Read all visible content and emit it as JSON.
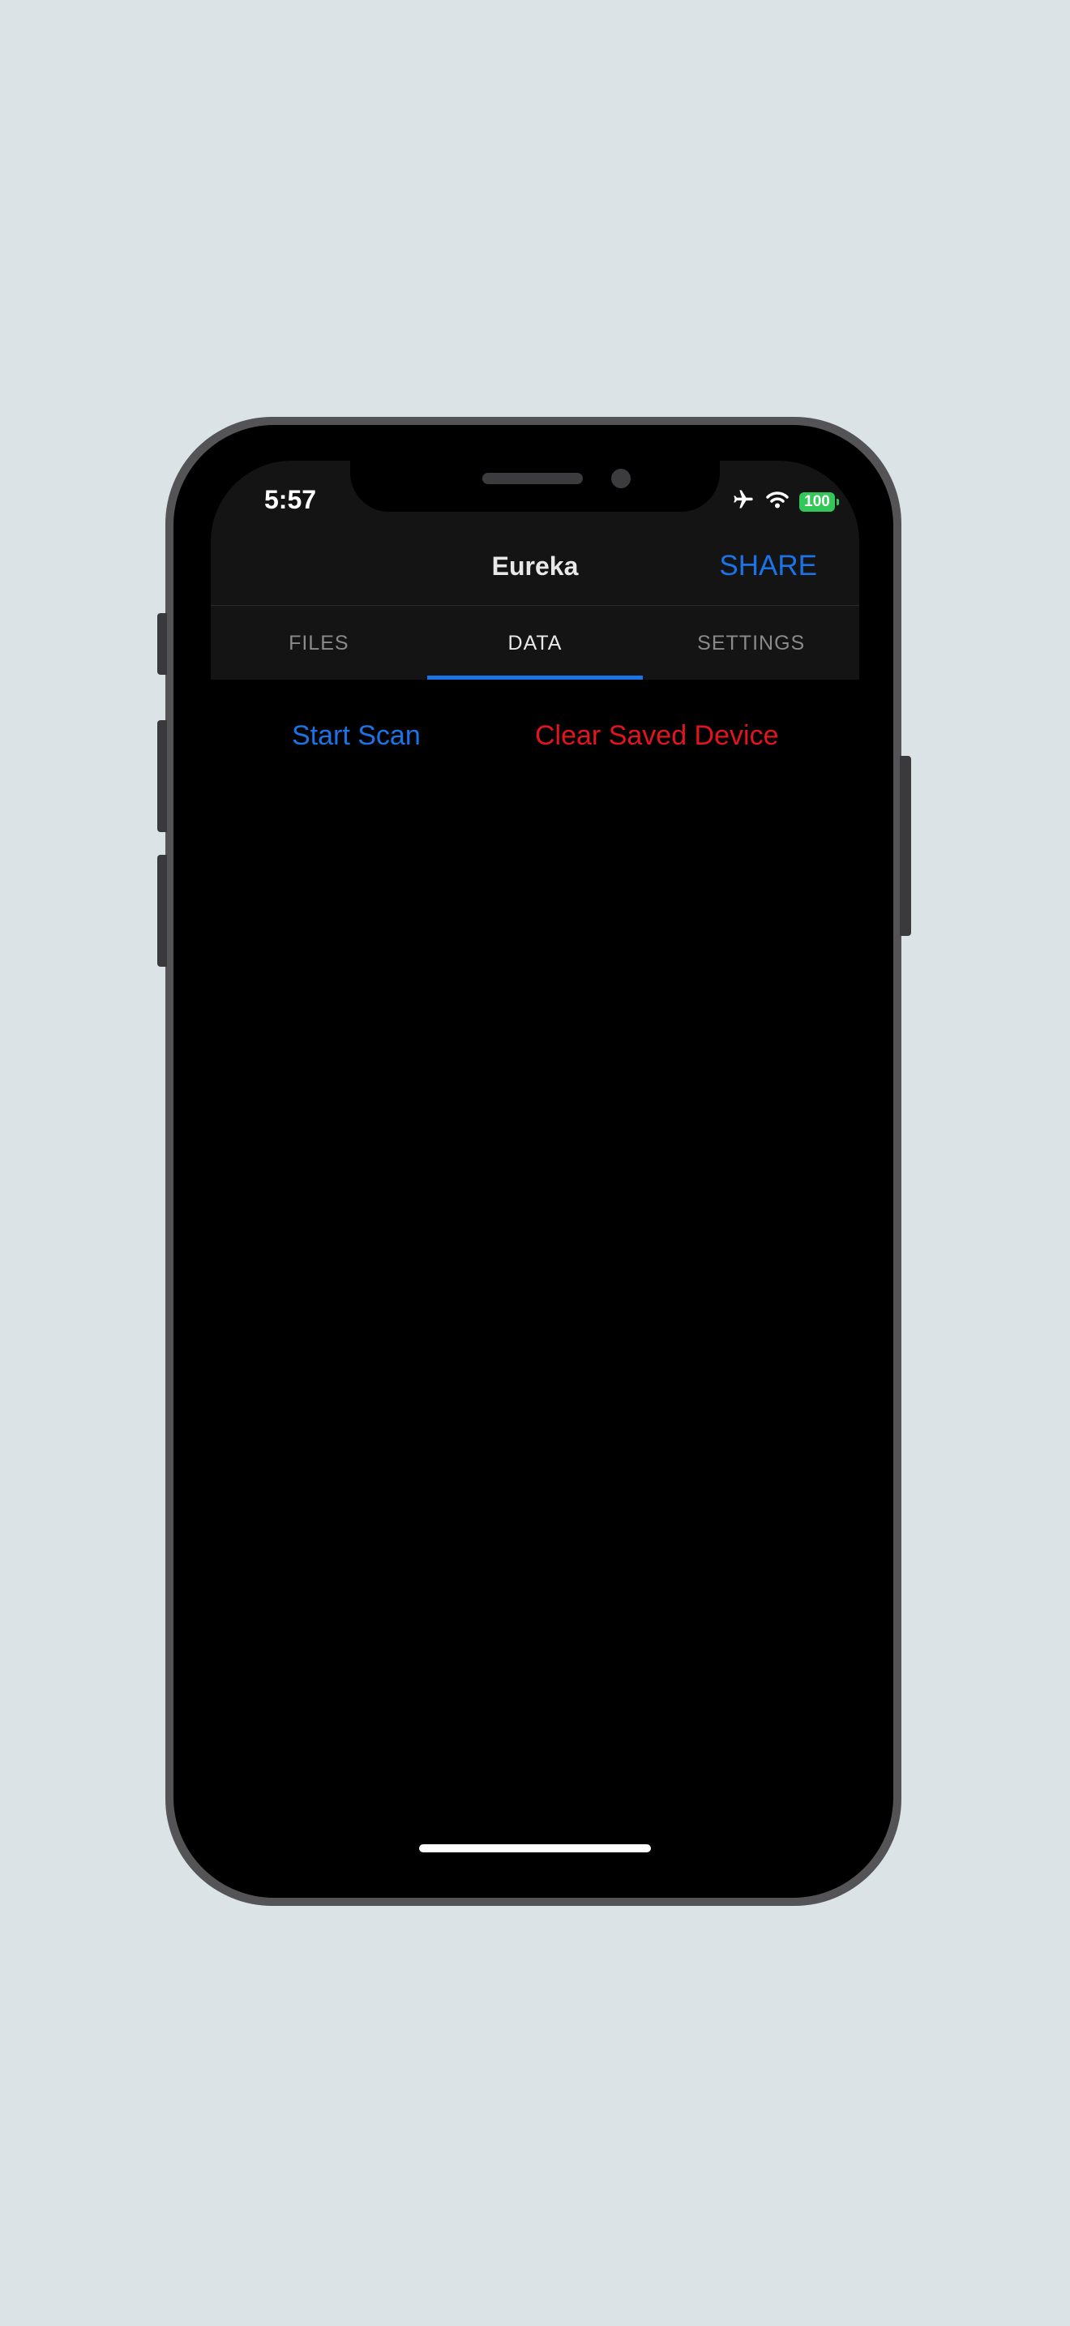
{
  "status_bar": {
    "time": "5:57",
    "battery": "100",
    "icons": [
      "airplane-icon",
      "wifi-icon",
      "battery-icon"
    ]
  },
  "nav": {
    "title": "Eureka",
    "share_label": "SHARE"
  },
  "tabs": [
    {
      "label": "FILES",
      "active": false
    },
    {
      "label": "DATA",
      "active": true
    },
    {
      "label": "SETTINGS",
      "active": false
    }
  ],
  "actions": {
    "start_scan_label": "Start Scan",
    "clear_saved_label": "Clear Saved Device"
  },
  "colors": {
    "accent": "#1a74e8",
    "danger": "#e3141d",
    "battery": "#33c759",
    "background": "#000000",
    "header": "#141414"
  }
}
